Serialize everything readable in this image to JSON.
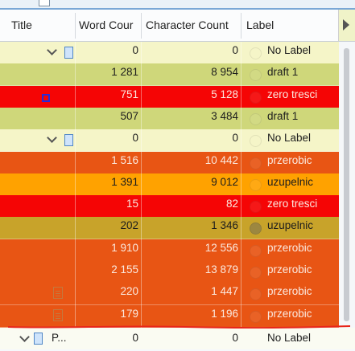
{
  "columns": {
    "title": "Title",
    "word_count": "Word Cour",
    "char_count": "Character Count",
    "label": "Label"
  },
  "colors": {
    "no_label": "#f5f5c8",
    "draft": "#cfd77a",
    "zero": "#f50505",
    "przerobic": "#e85514",
    "uzupelnic": "#ffa200",
    "uzupelnic_selected": "#c8a32a"
  },
  "rows": [
    {
      "wc": "0",
      "cc": "0",
      "label": "No Label",
      "kind": "no_label",
      "folder": true
    },
    {
      "wc": "1 281",
      "cc": "8 954",
      "label": "draft 1",
      "kind": "draft"
    },
    {
      "wc": "751",
      "cc": "5 128",
      "label": "zero tresci",
      "kind": "zero",
      "marker": true
    },
    {
      "wc": "507",
      "cc": "3 484",
      "label": "draft 1",
      "kind": "draft"
    },
    {
      "wc": "0",
      "cc": "0",
      "label": "No Label",
      "kind": "no_label",
      "folder": true
    },
    {
      "wc": "1 516",
      "cc": "10 442",
      "label": "przerobic",
      "kind": "przerobic"
    },
    {
      "wc": "1 391",
      "cc": "9 012",
      "label": "uzupelnic",
      "kind": "uzupelnic"
    },
    {
      "wc": "15",
      "cc": "82",
      "label": "zero tresci",
      "kind": "zero"
    },
    {
      "wc": "202",
      "cc": "1 346",
      "label": "uzupelnic",
      "kind": "uzupelnic_selected"
    },
    {
      "wc": "1 910",
      "cc": "12 556",
      "label": "przerobic",
      "kind": "przerobic"
    },
    {
      "wc": "2 155",
      "cc": "13 879",
      "label": "przerobic",
      "kind": "przerobic"
    },
    {
      "wc": "220",
      "cc": "1 447",
      "label": "przerobic",
      "kind": "przerobic",
      "page": true
    },
    {
      "wc": "179",
      "cc": "1 196",
      "label": "przerobic",
      "kind": "przerobic",
      "page": true
    }
  ],
  "bottom_row": {
    "title": "P...",
    "wc": "0",
    "cc": "0",
    "label": "No Label"
  }
}
